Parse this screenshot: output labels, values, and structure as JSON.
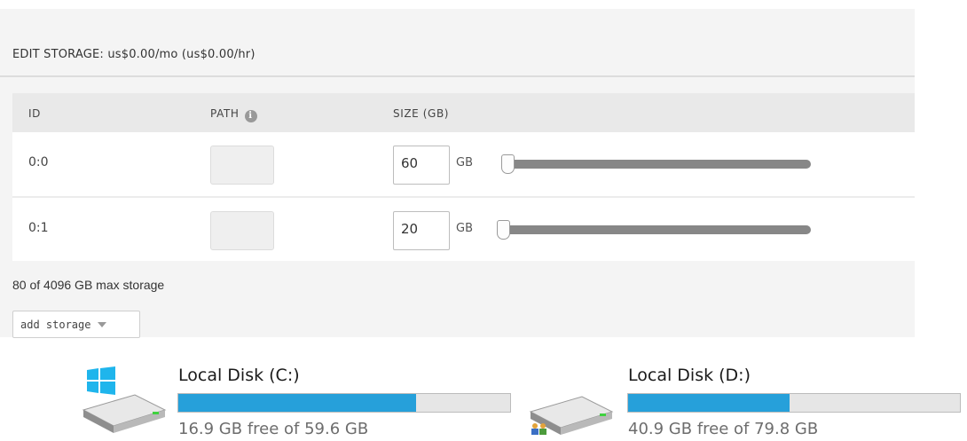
{
  "storage_panel": {
    "title": "EDIT STORAGE: us$0.00/mo (us$0.00/hr)",
    "columns": {
      "id": "ID",
      "path": "PATH",
      "size": "SIZE (GB)"
    },
    "rows": [
      {
        "id": "0:0",
        "size": "60",
        "unit": "GB",
        "slider_fraction": 0.015
      },
      {
        "id": "0:1",
        "size": "20",
        "unit": "GB",
        "slider_fraction": 0.0
      }
    ],
    "max_storage_text": "80 of 4096 GB max storage",
    "add_storage_label": "add storage"
  },
  "disks": [
    {
      "name": "Local Disk (C:)",
      "free_text": "16.9 GB free of 59.6 GB",
      "used_fraction": 0.717,
      "icon": "windows-drive-icon"
    },
    {
      "name": "Local Disk (D:)",
      "free_text": "40.9 GB free of 79.8 GB",
      "used_fraction": 0.487,
      "icon": "network-drive-icon"
    }
  ],
  "colors": {
    "panel_bg": "#f4f4f4",
    "slider_fill": "#7cbf52",
    "slider_track": "#878787",
    "disk_bar_fill": "#26a0da"
  }
}
